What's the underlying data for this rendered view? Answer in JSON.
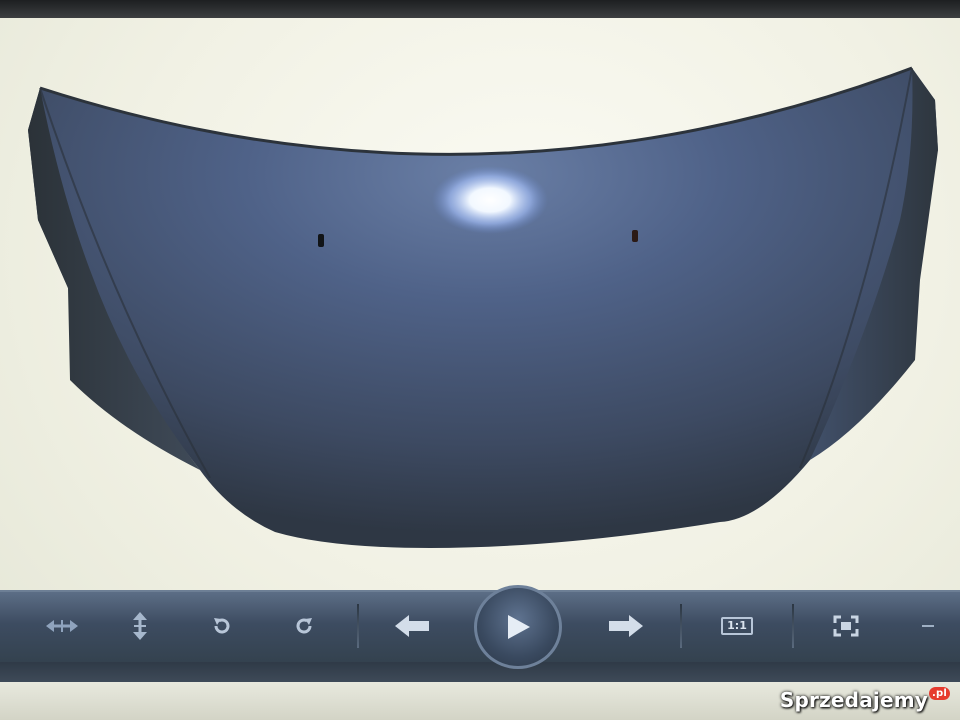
{
  "viewer": {
    "image_subject": "car-hood",
    "toolbar": {
      "buttons": [
        {
          "id": "fit-width",
          "icon": "fit-width-icon"
        },
        {
          "id": "fit-height",
          "icon": "fit-height-icon"
        },
        {
          "id": "rotate-left",
          "icon": "rotate-ccw-icon"
        },
        {
          "id": "rotate-right",
          "icon": "rotate-cw-icon"
        },
        {
          "id": "previous",
          "icon": "arrow-left-icon"
        },
        {
          "id": "play",
          "icon": "play-icon"
        },
        {
          "id": "next",
          "icon": "arrow-right-icon"
        },
        {
          "id": "actual-size",
          "icon": "actual-size-icon",
          "label": "1:1"
        },
        {
          "id": "fullscreen",
          "icon": "fullscreen-icon"
        },
        {
          "id": "more",
          "icon": "minus-icon"
        }
      ]
    }
  },
  "watermark": {
    "brand": "Sprzedajemy",
    "tld": ".pl"
  },
  "colors": {
    "toolbar": "#3d4c61",
    "icon": "#c4cfdc",
    "hood": "#46566e"
  }
}
